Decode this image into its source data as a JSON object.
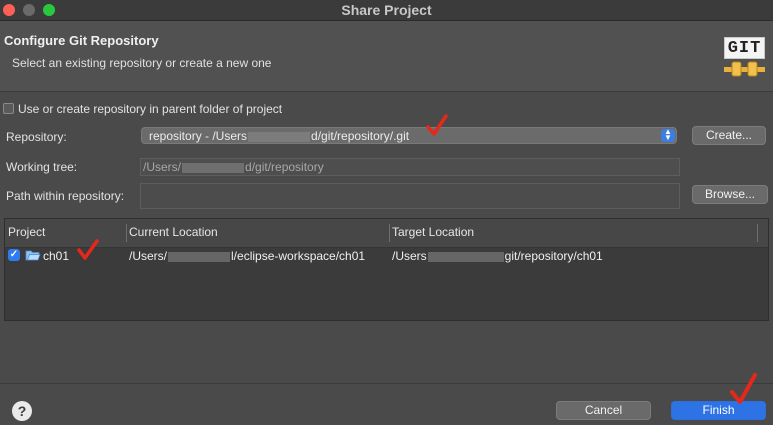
{
  "window": {
    "title": "Share Project"
  },
  "header": {
    "title": "Configure Git Repository",
    "subtitle": "Select an existing repository or create a new one",
    "logo_text": "GIT"
  },
  "options": {
    "parent_folder_label": "Use or create repository in parent folder of project",
    "parent_folder_checked": false
  },
  "repository": {
    "label": "Repository:",
    "value_prefix": "repository - /Users",
    "value_suffix": "d/git/repository/.git",
    "create_label": "Create..."
  },
  "working_tree": {
    "label": "Working tree:",
    "value_prefix": "/Users/",
    "value_suffix": "d/git/repository"
  },
  "path_within": {
    "label": "Path within repository:",
    "value": "",
    "browse_label": "Browse..."
  },
  "table": {
    "columns": [
      "Project",
      "Current Location",
      "Target Location"
    ],
    "rows": [
      {
        "checked": true,
        "project": "ch01",
        "current_prefix": "/Users/",
        "current_suffix": "l/eclipse-workspace/ch01",
        "target_prefix": "/Users",
        "target_suffix": "git/repository/ch01"
      }
    ]
  },
  "footer": {
    "help_icon": "?",
    "cancel_label": "Cancel",
    "finish_label": "Finish"
  },
  "colors": {
    "accent": "#2f7cf0",
    "finish_button": "#2e73e6",
    "annotation_red": "#e8271b",
    "git_green": "#2f8f2f",
    "git_gold": "#e8b23a"
  }
}
